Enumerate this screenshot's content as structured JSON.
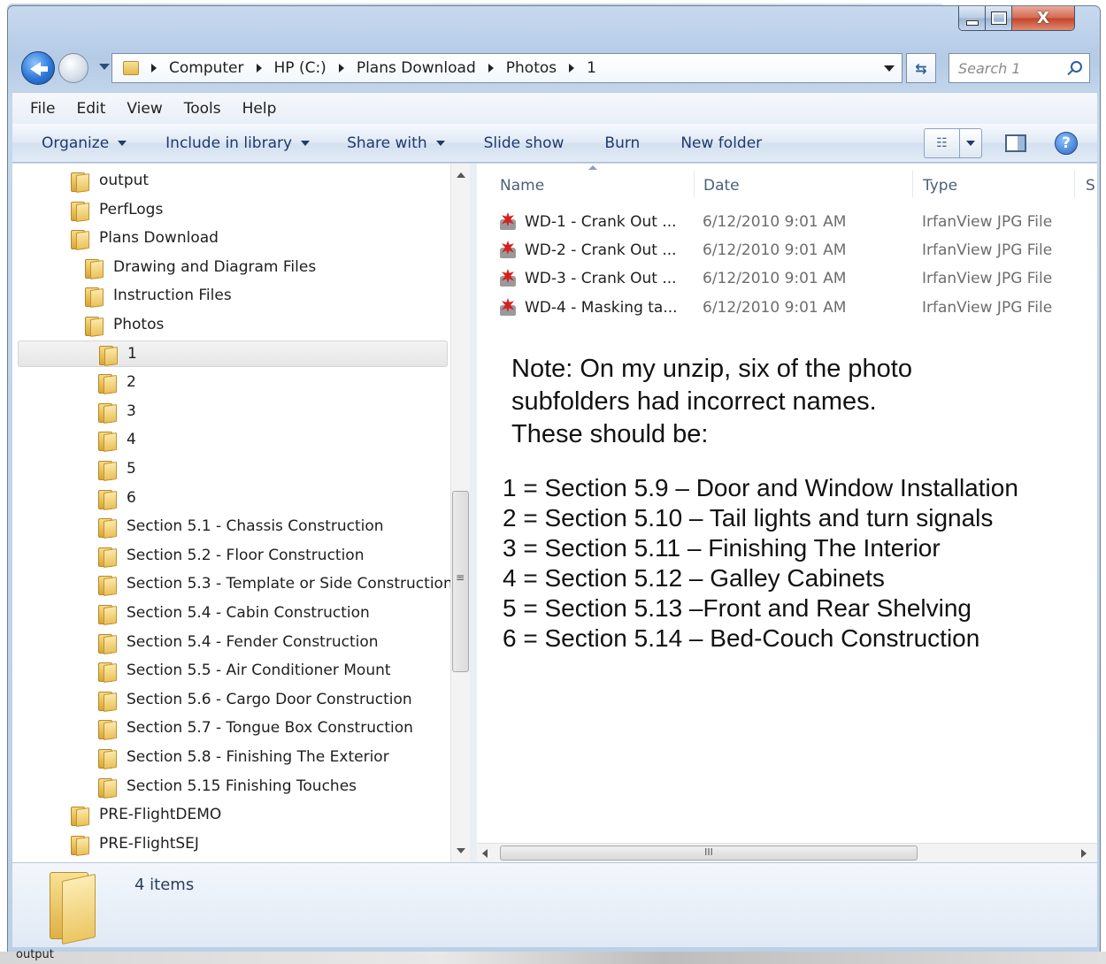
{
  "window": {
    "close_glyph": "X"
  },
  "address": {
    "crumbs": [
      "Computer",
      "HP (C:)",
      "Plans Download",
      "Photos",
      "1"
    ]
  },
  "search": {
    "placeholder": "Search 1"
  },
  "menubar": {
    "items": [
      "File",
      "Edit",
      "View",
      "Tools",
      "Help"
    ]
  },
  "commandbar": {
    "organize": "Organize",
    "include": "Include in library",
    "share": "Share with",
    "slideshow": "Slide show",
    "burn": "Burn",
    "new_folder": "New folder",
    "help": "?"
  },
  "tree": {
    "items": [
      {
        "label": "output",
        "level": 0
      },
      {
        "label": "PerfLogs",
        "level": 0
      },
      {
        "label": "Plans Download",
        "level": 0
      },
      {
        "label": "Drawing and Diagram Files",
        "level": 1
      },
      {
        "label": "Instruction Files",
        "level": 1
      },
      {
        "label": "Photos",
        "level": 1
      },
      {
        "label": "1",
        "level": 2,
        "selected": true
      },
      {
        "label": "2",
        "level": 2
      },
      {
        "label": "3",
        "level": 2
      },
      {
        "label": "4",
        "level": 2
      },
      {
        "label": "5",
        "level": 2
      },
      {
        "label": "6",
        "level": 2
      },
      {
        "label": "Section 5.1 - Chassis Construction",
        "level": 2
      },
      {
        "label": "Section 5.2 - Floor Construction",
        "level": 2
      },
      {
        "label": "Section 5.3 - Template or Side Construction",
        "level": 2
      },
      {
        "label": "Section 5.4 - Cabin Construction",
        "level": 2
      },
      {
        "label": "Section 5.4 - Fender Construction",
        "level": 2
      },
      {
        "label": "Section 5.5 - Air Conditioner Mount",
        "level": 2
      },
      {
        "label": "Section 5.6 - Cargo Door Construction",
        "level": 2
      },
      {
        "label": "Section 5.7 - Tongue Box Construction",
        "level": 2
      },
      {
        "label": "Section 5.8 - Finishing The Exterior",
        "level": 2
      },
      {
        "label": "Section 5.15  Finishing Touches",
        "level": 2
      },
      {
        "label": "PRE-FlightDEMO",
        "level": 0
      },
      {
        "label": "PRE-FlightSEJ",
        "level": 0
      }
    ]
  },
  "columns": {
    "name": "Name",
    "date": "Date",
    "type": "Type",
    "size_partial": "S"
  },
  "files": [
    {
      "name": "WD-1 - Crank Out ...",
      "date": "6/12/2010 9:01 AM",
      "type": "IrfanView JPG File"
    },
    {
      "name": "WD-2 - Crank Out ...",
      "date": "6/12/2010 9:01 AM",
      "type": "IrfanView JPG File"
    },
    {
      "name": "WD-3 - Crank Out ...",
      "date": "6/12/2010 9:01 AM",
      "type": "IrfanView JPG File"
    },
    {
      "name": "WD-4 -  Masking ta...",
      "date": "6/12/2010 9:01 AM",
      "type": "IrfanView JPG File"
    }
  ],
  "note": {
    "line1": "Note:  On my unzip, six of the photo",
    "line2": "subfolders had incorrect names.",
    "line3": "These should be:",
    "list": [
      "1 = Section 5.9 – Door and Window Installation",
      "2 = Section 5.10 – Tail lights and turn signals",
      "3 = Section 5.11 – Finishing The Interior",
      "4 = Section 5.12 – Galley Cabinets",
      "5 = Section 5.13 –Front and Rear Shelving",
      "6 = Section 5.14 – Bed-Couch Construction"
    ]
  },
  "status": {
    "item_count": "4 items"
  },
  "hscroll": {
    "grip": "III"
  },
  "taskbar": {
    "partial_text": "output"
  }
}
